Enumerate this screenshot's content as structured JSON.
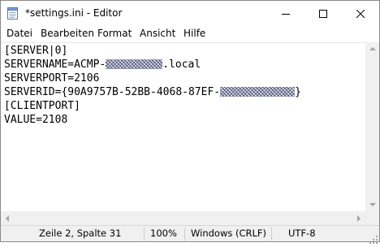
{
  "window": {
    "title": "*settings.ini - Editor"
  },
  "menu": {
    "items": [
      "Datei",
      "Bearbeiten",
      "Format",
      "Ansicht",
      "Hilfe"
    ]
  },
  "editor": {
    "lines": [
      {
        "text": "[SERVER|0]"
      },
      {
        "prefix": "SERVERNAME=ACMP-",
        "suffix": ".local",
        "redacted": true
      },
      {
        "text": "SERVERPORT=2106"
      },
      {
        "prefix": "SERVERID={90A9757B-52BB-4068-87EF-",
        "suffix": "}",
        "redacted": true
      },
      {
        "text": "[CLIENTPORT]"
      },
      {
        "text": "VALUE=2108"
      }
    ]
  },
  "statusbar": {
    "position": "Zeile 2, Spalte 31",
    "zoom": "100%",
    "line_ending": "Windows (CRLF)",
    "encoding": "UTF-8"
  },
  "icons": {
    "app": "notepad-icon",
    "minimize": "minimize-icon",
    "maximize": "maximize-icon",
    "close": "close-icon"
  },
  "colors": {
    "window_bg": "#ffffff",
    "chrome_bg": "#f0f0f0",
    "text": "#000000"
  }
}
